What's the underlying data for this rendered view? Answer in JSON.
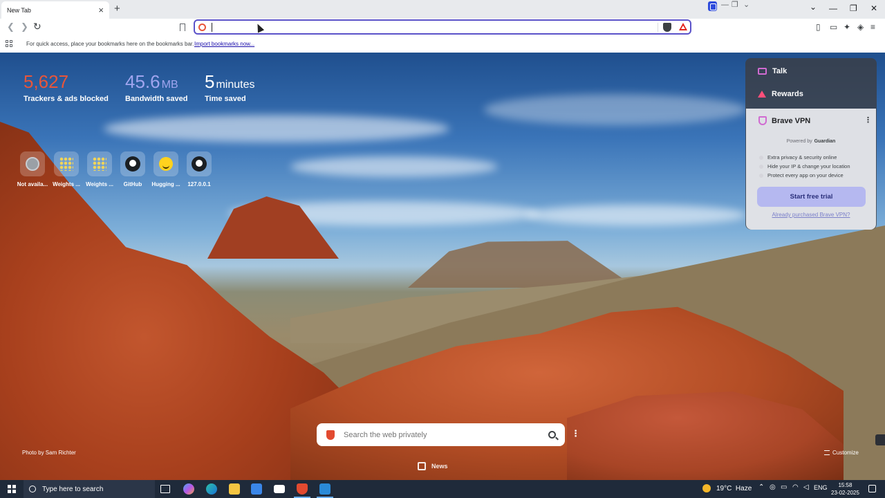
{
  "tab": {
    "title": "New Tab",
    "close_glyph": "×",
    "new_tab_glyph": "+"
  },
  "titlebar": {
    "minimize": "—",
    "restore": "❐",
    "close": "✕",
    "chevron": "⌄"
  },
  "toolbar": {
    "back_glyph": "❮",
    "forward_glyph": "❯",
    "reload_glyph": "↻",
    "address_value": "",
    "icons": [
      "bookmark-icon",
      "site-info-icon",
      "brave-shields-icon",
      "brave-rewards-icon",
      "sidebar-icon",
      "wallet-icon",
      "leo-ai-icon",
      "vpn-icon",
      "menu-icon"
    ]
  },
  "bookmarks_bar": {
    "message": "For quick access, place your bookmarks here on the bookmarks bar.",
    "import_link": "Import bookmarks now..."
  },
  "stats": {
    "trackers": {
      "value": "5,627",
      "label": "Trackers & ads blocked"
    },
    "bandwidth": {
      "value": "45.6",
      "unit": "MB",
      "label": "Bandwidth saved"
    },
    "time": {
      "value": "5",
      "unit": "minutes",
      "label": "Time saved"
    }
  },
  "top_sites": [
    {
      "label": "Not availa..."
    },
    {
      "label": "Weights ..."
    },
    {
      "label": "Weights ..."
    },
    {
      "label": "GitHub"
    },
    {
      "label": "Hugging ..."
    },
    {
      "label": "127.0.0.1"
    }
  ],
  "widget": {
    "talk": "Talk",
    "rewards": "Rewards",
    "vpn": {
      "title": "Brave VPN",
      "menu_glyph": "⋮",
      "powered_by": "Powered by",
      "partner": "Guardian",
      "features": [
        "Extra privacy & security online",
        "Hide your IP & change your location",
        "Protect every app on your device"
      ],
      "cta": "Start free trial",
      "already_purchased": "Already purchased Brave VPN?"
    }
  },
  "search": {
    "placeholder": "Search the web privately",
    "more_glyph": "⋮"
  },
  "photo_credit": "Photo by Sam Richter",
  "news": {
    "label": "News"
  },
  "customize": {
    "label": "Customize"
  },
  "taskbar": {
    "search_placeholder": "Type here to search",
    "weather": {
      "temp": "19°C",
      "condition": "Haze"
    },
    "language": "ENG",
    "time": "15:58",
    "date": "23-02-2025",
    "tray_up_glyph": "⌃"
  }
}
